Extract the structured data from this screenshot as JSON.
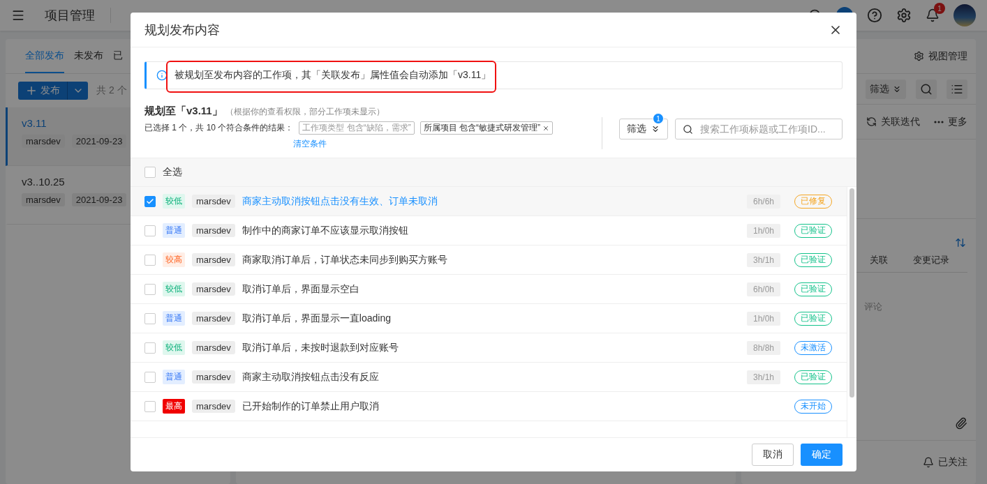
{
  "topbar": {
    "title": "项目管理",
    "notification_count": "1"
  },
  "release_panel": {
    "tabs": [
      {
        "label": "全部发布",
        "selected": true
      },
      {
        "label": "未发布",
        "selected": false
      },
      {
        "label": "已",
        "selected": false
      }
    ],
    "new_button": "发布",
    "count": "共 2 个",
    "releases": [
      {
        "name": "v3.11",
        "owner": "marsdev",
        "date": "2021-09-23",
        "selected": true
      },
      {
        "name": "v3..10.25",
        "owner": "marsdev",
        "date": "2021-09-23",
        "selected": false
      }
    ]
  },
  "detail_panel": {
    "view_manage": "视图管理",
    "filter": "筛选",
    "link_iteration": "关联迭代",
    "more": "更多",
    "tabs": [
      "关联",
      "变更记录"
    ],
    "comment": "评论",
    "follow": "已关注"
  },
  "dialog": {
    "title": "规划发布内容",
    "notice": "被规划至发布内容的工作项，其「关联发布」属性值会自动添加「v3.11」",
    "heading": "规划至「v3.11」",
    "heading_note": "（根据你的查看权限，部分工作项未显示）",
    "summary": "已选择 1 个，共 10 个符合条件的结果：",
    "conditions": [
      {
        "text": "工作项类型 包含“缺陷，需求”",
        "removable": false
      },
      {
        "text": "所属项目 包含“敏捷式研发管理”",
        "removable": true
      }
    ],
    "clear": "清空条件",
    "filter_button": "筛选",
    "filter_count": "1",
    "search_placeholder": "搜索工作项标题或工作项ID...",
    "select_all": {
      "label": "全选",
      "checked": false
    },
    "items": [
      {
        "checked": true,
        "priority": {
          "label": "较低",
          "kind": "low"
        },
        "owner": "marsdev",
        "title": "商家主动取消按钮点击没有生效、订单未取消",
        "hours": "6h/6h",
        "status": {
          "label": "已修复",
          "color": "#f5a623"
        }
      },
      {
        "checked": false,
        "priority": {
          "label": "普通",
          "kind": "normal"
        },
        "owner": "marsdev",
        "title": "制作中的商家订单不应该显示取消按钮",
        "hours": "1h/0h",
        "status": {
          "label": "已验证",
          "color": "#12c28a"
        }
      },
      {
        "checked": false,
        "priority": {
          "label": "较高",
          "kind": "high"
        },
        "owner": "marsdev",
        "title": "商家取消订单后，订单状态未同步到购买方账号",
        "hours": "3h/1h",
        "status": {
          "label": "已验证",
          "color": "#12c28a"
        }
      },
      {
        "checked": false,
        "priority": {
          "label": "较低",
          "kind": "low"
        },
        "owner": "marsdev",
        "title": "取消订单后，界面显示空白",
        "hours": "6h/0h",
        "status": {
          "label": "已验证",
          "color": "#12c28a"
        }
      },
      {
        "checked": false,
        "priority": {
          "label": "普通",
          "kind": "normal"
        },
        "owner": "marsdev",
        "title": "取消订单后，界面显示一直loading",
        "hours": "1h/0h",
        "status": {
          "label": "已验证",
          "color": "#12c28a"
        }
      },
      {
        "checked": false,
        "priority": {
          "label": "较低",
          "kind": "low"
        },
        "owner": "marsdev",
        "title": "取消订单后，未按时退款到对应账号",
        "hours": "8h/8h",
        "status": {
          "label": "未激活",
          "color": "#1890ff"
        }
      },
      {
        "checked": false,
        "priority": {
          "label": "普通",
          "kind": "normal"
        },
        "owner": "marsdev",
        "title": "商家主动取消按钮点击没有反应",
        "hours": "3h/1h",
        "status": {
          "label": "已验证",
          "color": "#12c28a"
        }
      },
      {
        "checked": false,
        "priority": {
          "label": "最高",
          "kind": "highest"
        },
        "owner": "marsdev",
        "title": "已开始制作的订单禁止用户取消",
        "status": {
          "label": "未开始",
          "color": "#1890ff"
        }
      }
    ],
    "cancel": "取消",
    "confirm": "确定"
  }
}
